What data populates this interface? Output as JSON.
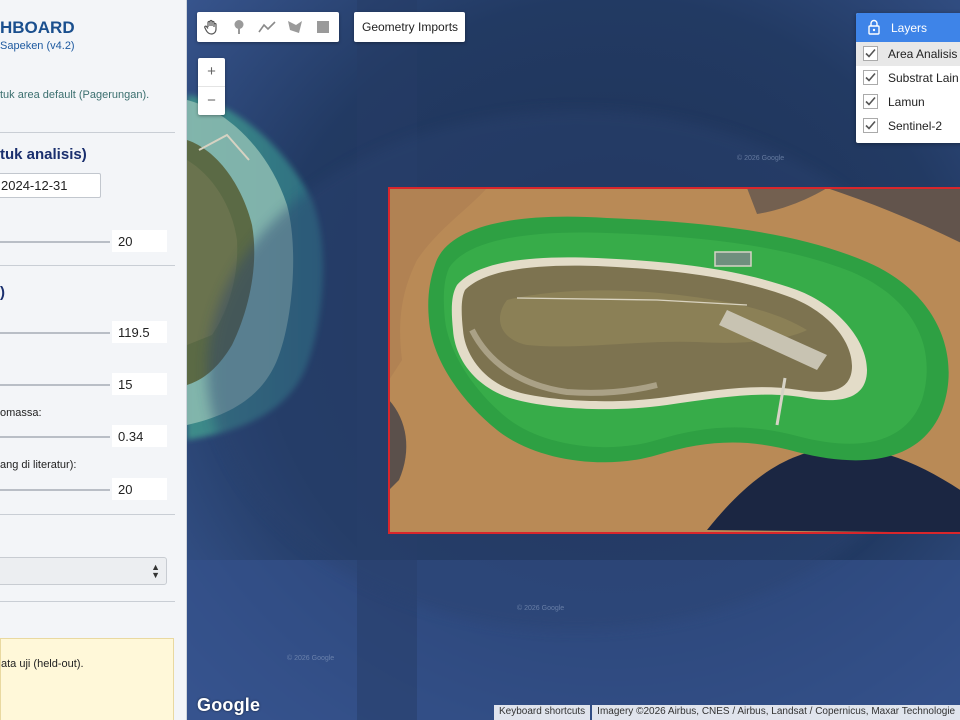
{
  "panel": {
    "title": "HBOARD",
    "subtitle": "Sapeken (v4.2)",
    "note": "tuk area default (Pagerungan).",
    "section_analysis": "tuk analisis)",
    "end_date": "2024-12-31",
    "slider1_value": "20",
    "section_two": ")",
    "slider2_value": "119.5",
    "slider3_value": "15",
    "label_biomass": "omassa:",
    "slider4_value": "0.34",
    "label_literature": "ang di literatur):",
    "slider5_value": "20",
    "select_value": "",
    "info_text": "ata uji (held-out)."
  },
  "map": {
    "tools": [
      "hand-icon",
      "marker-icon",
      "polyline-icon",
      "polygon-icon",
      "rectangle-icon"
    ],
    "geometry_imports_label": "Geometry Imports",
    "zoom_in": "+",
    "zoom_out": "−",
    "layers": {
      "title": "Layers",
      "items": [
        {
          "label": "Area Analisis",
          "checked": true
        },
        {
          "label": "Substrat Lain",
          "checked": true
        },
        {
          "label": "Lamun",
          "checked": true
        },
        {
          "label": "Sentinel-2",
          "checked": true
        }
      ]
    },
    "google_logo": "Google",
    "keyboard_shortcuts": "Keyboard shortcuts",
    "imagery_credit": "Imagery ©2026 Airbus, CNES / Airbus, Landsat / Copernicus, Maxar Technologie",
    "colors": {
      "seagrass": "#2ea043",
      "substrate": "#b98a56",
      "analysis_area": "#d9262b",
      "layers_header": "#3e84e8",
      "deep_water": "#22365a"
    }
  }
}
